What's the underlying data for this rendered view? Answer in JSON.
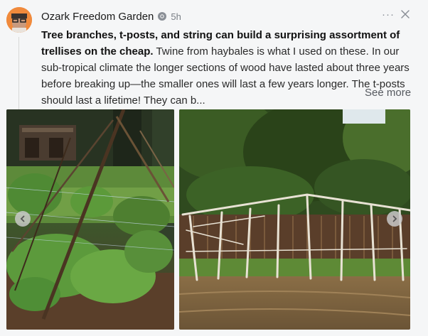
{
  "post": {
    "author": "Ozark Freedom Garden",
    "time": "5h",
    "more_label": "···",
    "headline": "Tree branches, t-posts, and string can build a surprising assortment of trellises on the cheap.",
    "body": " Twine from haybales is what I used on these. In our sub-tropical climate the longer sections of wood have lasted about three years before breaking up—the smaller ones will last a few years longer. The t-posts should last a lifetime! They can b...",
    "see_more": "See more"
  },
  "icons": {
    "badge": "freedom-badge-icon",
    "close": "close-icon",
    "prev": "chevron-left-icon",
    "next": "chevron-right-icon"
  },
  "colors": {
    "background": "#f5f6f7",
    "avatar": "#f08a3c",
    "muted": "#7a7f86"
  }
}
